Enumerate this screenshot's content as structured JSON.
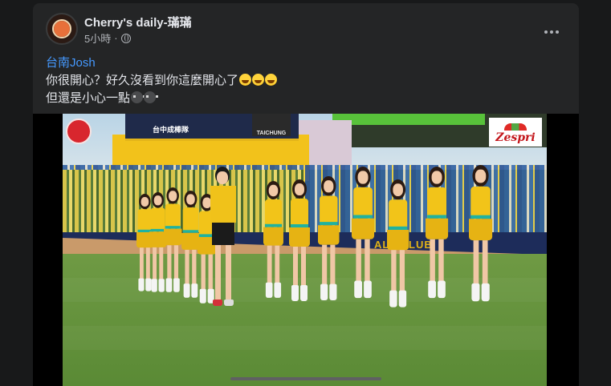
{
  "post": {
    "author": "Cherry's daily-璊璊",
    "time": "5小時",
    "privacy_icon": "globe-icon",
    "more_icon": "more-icon",
    "text": {
      "mention": "台南Josh",
      "line1": "你很開心？好久沒看到你這麼開心了",
      "line2": "但還是小心一點",
      "line1_emojis": [
        "rofl-emoji",
        "rofl-emoji",
        "rofl-emoji"
      ],
      "line2_emojis": [
        "dark-sunglasses-emoji",
        "dark-sunglasses-emoji"
      ]
    }
  },
  "video": {
    "stadium_sign_text": "台中成棒隊",
    "wall_text": "ALL CLUB",
    "team_board": "TAICHUNG",
    "sponsor": "Zespri"
  },
  "colors": {
    "background": "#18191a",
    "card": "#242526",
    "text_primary": "#e4e6eb",
    "text_secondary": "#b0b3b8",
    "mention": "#4599ff"
  }
}
